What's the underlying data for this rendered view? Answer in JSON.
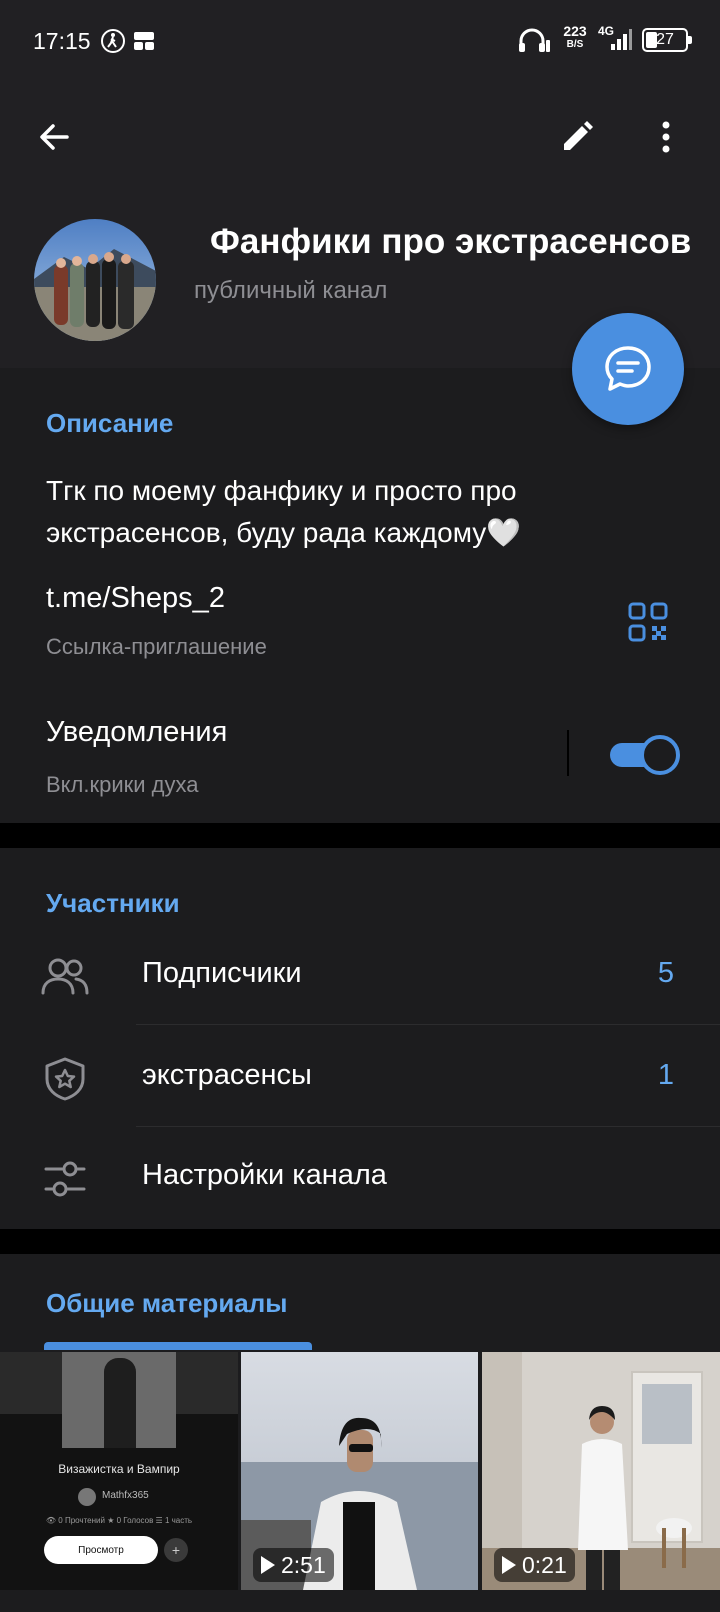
{
  "status_bar": {
    "time": "17:15",
    "net_speed_value": "223",
    "net_speed_unit": "B/S",
    "network_type": "4G",
    "battery": "27"
  },
  "toolbar": {
    "back_icon": "arrow-left-icon",
    "edit_icon": "pencil-icon",
    "more_icon": "more-vertical-icon"
  },
  "channel": {
    "title": "Фанфики про экстрасенсов",
    "subtitle": "публичный канал"
  },
  "info": {
    "section_title": "Описание",
    "description": "Тгк по моему фанфику и просто про экстрасенсов, буду рада каждому🤍",
    "link": "t.me/Sheps_2",
    "link_label": "Ссылка-приглашение",
    "notifications_label": "Уведомления",
    "notifications_value": "Вкл.крики духа",
    "notifications_enabled": true
  },
  "members": {
    "section_title": "Участники",
    "rows": [
      {
        "label": "Подписчики",
        "count": "5",
        "icon": "users-icon"
      },
      {
        "label": "экстрасенсы",
        "count": "1",
        "icon": "shield-star-icon"
      },
      {
        "label": "Настройки канала",
        "count": "",
        "icon": "sliders-icon"
      }
    ]
  },
  "media": {
    "section_title": "Общие материалы",
    "items": [
      {
        "type": "image",
        "story_title": "Визажистка и Вампир",
        "author": "Mathfx365",
        "stats": "👁 0 Прочтений   ★ 0 Голосов   ☰ 1 часть",
        "button": "Просмотр",
        "plus": "+"
      },
      {
        "type": "video",
        "duration": "2:51"
      },
      {
        "type": "video",
        "duration": "0:21"
      }
    ]
  },
  "colors": {
    "accent": "#4a8fe0",
    "accent_text": "#64a9f0",
    "card_bg": "#1c1c1e",
    "header_bg": "#212023",
    "muted": "#8e8e93"
  }
}
